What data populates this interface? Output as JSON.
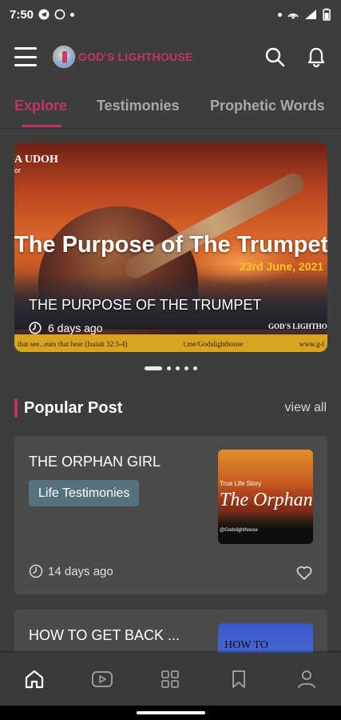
{
  "status_bar": {
    "time": "7:50"
  },
  "app_bar": {
    "logo_text": "GOD'S LIGHTHOUSE"
  },
  "tabs": [
    {
      "label": "Explore",
      "active": true
    },
    {
      "label": "Testimonies",
      "active": false
    },
    {
      "label": "Prophetic Words",
      "active": false
    }
  ],
  "carousel": {
    "kicker": "A UDOH",
    "kicker_sub": "or",
    "graphic_title": "The Purpose of The Trumpet",
    "graphic_date": "23rd June, 2021",
    "caption": "THE PURPOSE OF THE TRUMPET",
    "time_ago": "6 days ago",
    "footer_left": "that see...ears that hear (Isaiah 32:3-4)",
    "footer_mid": "t.me/Godslighthouse",
    "footer_right": "www.g-l",
    "brand": "GOD'S LIGHTHO",
    "slide_count": 5,
    "active_index": 0
  },
  "popular": {
    "title": "Popular Post",
    "view_all": "view all",
    "posts": [
      {
        "title": "THE ORPHAN GIRL",
        "category": "Life Testimonies",
        "time_ago": "14 days ago",
        "thumb_kicker": "True Life Story",
        "thumb_title": "The Orphan Girl",
        "thumb_foot": "@Godslighthouse"
      },
      {
        "title": "HOW TO GET BACK ...",
        "thumb_text": "HOW TO"
      }
    ]
  },
  "colors": {
    "accent": "#c2336b",
    "background": "#3d3d3d",
    "card": "#4b4b4b",
    "chip": "#56727e"
  },
  "bottom_nav": [
    "home-icon",
    "video-icon",
    "grid-icon",
    "bookmark-icon",
    "profile-icon"
  ]
}
